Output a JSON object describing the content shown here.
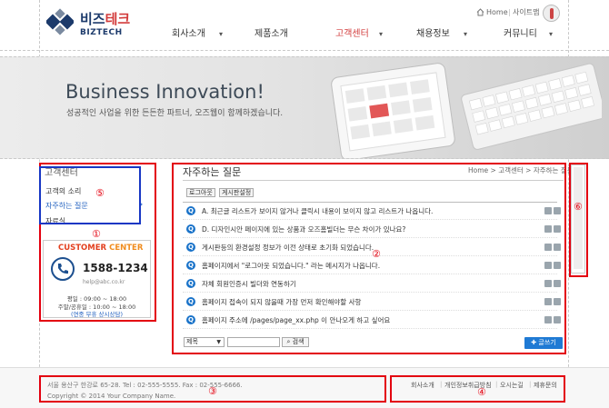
{
  "logo": {
    "name_main": "비즈",
    "name_accent": "테크",
    "name_en": "BIZTECH"
  },
  "header": {
    "home_link": "Home",
    "divider": "|",
    "sitemap_link": "사이트맵"
  },
  "nav": [
    {
      "label": "회사소개",
      "caret": "▾"
    },
    {
      "label": "제품소개",
      "caret": ""
    },
    {
      "label": "고객센터",
      "caret": "▾"
    },
    {
      "label": "채용정보",
      "caret": "▾"
    },
    {
      "label": "커뮤니티",
      "caret": "▾"
    }
  ],
  "banner": {
    "title": "Business Innovation!",
    "subtitle": "성공적인 사업을 위한 든든한 파트너, 오즈웹이 함께하겠습니다."
  },
  "sidebar": {
    "title": "고객센터",
    "items": [
      "고객의 소리",
      "자주하는 질문",
      "자료실"
    ],
    "arrow": "›",
    "cc_title_1": "CUSTOMER",
    "cc_title_2": "CENTER",
    "phone": "1588-1234",
    "email": "help@abc.co.kr",
    "hours_weekday": "평일 : 09:00 ~ 18:00",
    "hours_weekend": "주말/공휴일 : 10:00 ~ 18:00",
    "note": "(연중 무휴 상시상담)"
  },
  "main": {
    "title": "자주하는 질문",
    "breadcrumb": "Home > 고객센터 > 자주하는 질문",
    "buttons": [
      "로그아웃",
      "게시판설정"
    ],
    "q_mark": "Q",
    "faqs": [
      "A. 최근글 리스트가 보이지 않거나 클릭시 내용이 보이지 않고 리스트가 나옵니다.",
      "D. 디자인시안 페이지에 있는 상품과 오즈홈빌더는 무슨 차이가 있나요?",
      "게시판등의 환경설정 정보가 이전 상태로 초기화 되었습니다.",
      "홈페이지에서 \"로그아웃 되었습니다.\" 라는 메시지가 나옵니다.",
      "자체 회원인증시 빌더와 연동하기",
      "홈페이지 접속이 되지 않을때 가장 먼저 확인해야할 사항",
      "홈페이지 주소에 /pages/page_xx.php 이 안나오게 하고 싶어요"
    ],
    "search_select": "제목",
    "search_button": "검색",
    "write_button": "글쓰기"
  },
  "footer": {
    "address": "서울 용산구 한강로 65-28. Tel : 02-555-5555. Fax : 02-555-6666.",
    "copyright": "Copyright © 2014 Your Company Name.",
    "links": [
      "회사소개",
      "개인정보취급방침",
      "오시는길",
      "제휴문의"
    ],
    "sep": "|"
  },
  "annotations": [
    "①",
    "②",
    "③",
    "④",
    "⑤",
    "⑥"
  ],
  "colors": {
    "annotation_red": "#e3000f",
    "annotation_blue": "#1737c4",
    "accent_blue": "#1f7ad4",
    "accent_red": "#d23a3a",
    "cc_orange": "#f08c1e",
    "navy": "#1c3a6b"
  }
}
